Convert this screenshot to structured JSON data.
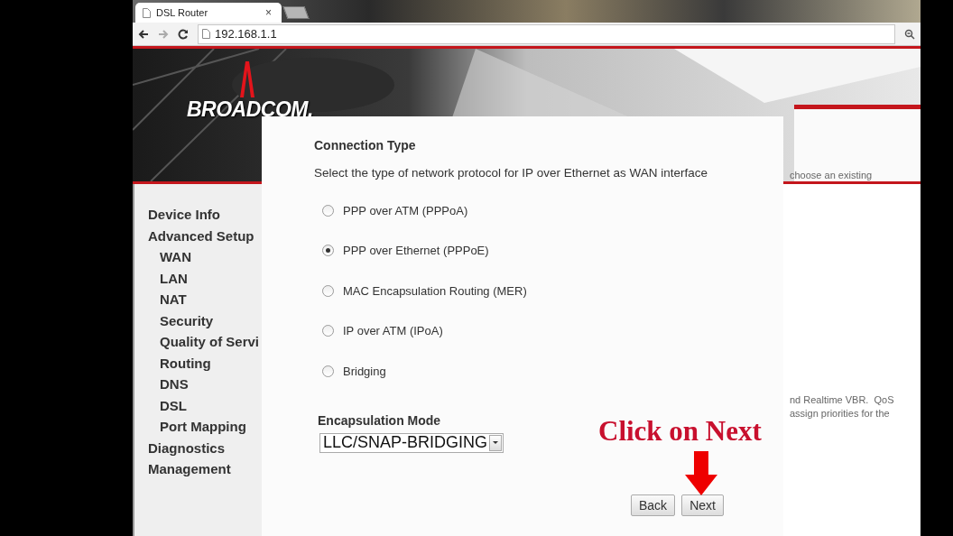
{
  "browser": {
    "tab": {
      "title": "DSL Router",
      "close": "×"
    },
    "address": "192.168.1.1"
  },
  "header": {
    "logo": "BROADCOM."
  },
  "sidebar": {
    "items": [
      {
        "label": "Device Info"
      },
      {
        "label": "Advanced Setup",
        "children": [
          {
            "label": "WAN"
          },
          {
            "label": "LAN"
          },
          {
            "label": "NAT"
          },
          {
            "label": "Security"
          },
          {
            "label": "Quality of Servi"
          },
          {
            "label": "Routing"
          },
          {
            "label": "DNS"
          },
          {
            "label": "DSL"
          },
          {
            "label": "Port Mapping"
          }
        ]
      },
      {
        "label": "Diagnostics"
      },
      {
        "label": "Management"
      }
    ]
  },
  "background_page": {
    "top_fragment": "choose an existing",
    "lower_fragment": [
      "nd Realtime VBR.  QoS",
      "assign priorities for the"
    ]
  },
  "dialog": {
    "title": "Connection Type",
    "description": "Select the type of network protocol for IP over Ethernet as WAN interface",
    "options": [
      {
        "label": "PPP over ATM (PPPoA)",
        "selected": false
      },
      {
        "label": "PPP over Ethernet (PPPoE)",
        "selected": true
      },
      {
        "label": "MAC Encapsulation Routing (MER)",
        "selected": false
      },
      {
        "label": "IP over ATM (IPoA)",
        "selected": false
      },
      {
        "label": "Bridging",
        "selected": false
      }
    ],
    "encapsulation": {
      "label": "Encapsulation Mode",
      "value": "LLC/SNAP-BRIDGING"
    },
    "buttons": [
      "Back",
      "Next"
    ]
  },
  "annotation": {
    "text": "Click on Next"
  }
}
